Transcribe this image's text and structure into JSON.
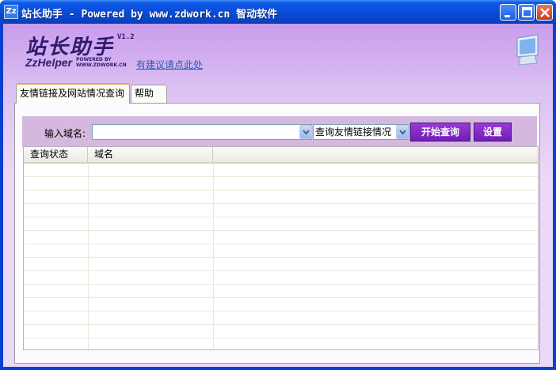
{
  "window": {
    "title": "站长助手 - Powered by www.zdwork.cn 智动软件",
    "app_icon_text": "Zz",
    "controls": [
      "minimize-icon",
      "maximize-icon",
      "close-icon"
    ]
  },
  "header": {
    "brand": "站长助手",
    "version": "V1.2",
    "sub_brand": "ZzHelper",
    "powered": "POWERED BY WWW.ZDWORK.CN",
    "suggest_link": "有建议请点此处",
    "decor_icon": "monitor-icon"
  },
  "tabs": [
    {
      "label": "友情链接及网站情况查询",
      "active": true
    },
    {
      "label": "帮助",
      "active": false
    }
  ],
  "query": {
    "domain_label": "输入域名:",
    "domain_value": "",
    "mode_selected": "查询友情链接情况",
    "start_button": "开始查询",
    "settings_button": "设置"
  },
  "table": {
    "columns": [
      "查询状态",
      "域名",
      ""
    ],
    "rows": []
  },
  "colors": {
    "titlebar": "#0a4cd8",
    "client_top": "#c89cec",
    "client_bottom": "#eadaf7",
    "button": "#7a28c0",
    "brand_text": "#2e1a6e"
  }
}
